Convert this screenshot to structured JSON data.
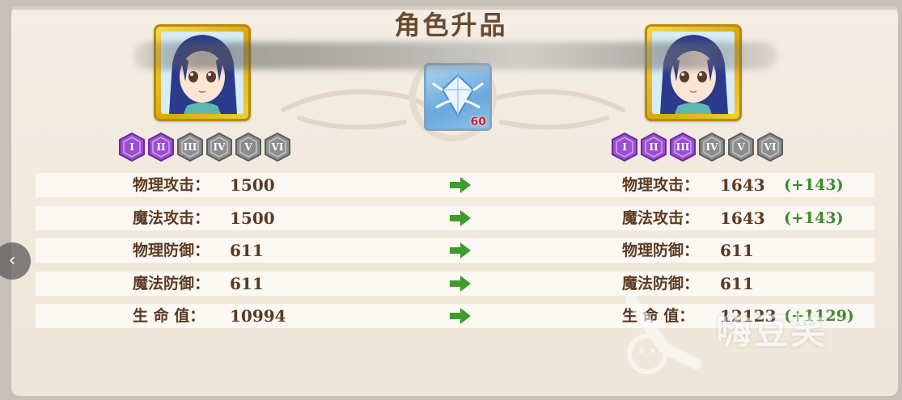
{
  "title": "角色升品",
  "before": {
    "ranks": [
      {
        "label": "I",
        "active": true
      },
      {
        "label": "II",
        "active": true
      },
      {
        "label": "III",
        "active": false
      },
      {
        "label": "IV",
        "active": false
      },
      {
        "label": "V",
        "active": false
      },
      {
        "label": "VI",
        "active": false
      }
    ]
  },
  "after": {
    "ranks": [
      {
        "label": "I",
        "active": true
      },
      {
        "label": "II",
        "active": true
      },
      {
        "label": "III",
        "active": true
      },
      {
        "label": "IV",
        "active": false
      },
      {
        "label": "V",
        "active": false
      },
      {
        "label": "VI",
        "active": false
      }
    ]
  },
  "material": {
    "icon": "crystal-icon",
    "count": "60"
  },
  "stats": [
    {
      "label": "物理攻击：",
      "before": "1500",
      "after": "1643",
      "diff": "(+143)"
    },
    {
      "label": "魔法攻击：",
      "before": "1500",
      "after": "1643",
      "diff": "(+143)"
    },
    {
      "label": "物理防御：",
      "before": "611",
      "after": "611",
      "diff": ""
    },
    {
      "label": "魔法防御：",
      "before": "611",
      "after": "611",
      "diff": ""
    },
    {
      "label": "生 命 值：",
      "before": "10994",
      "after": "12123",
      "diff": "(+1129)"
    }
  ],
  "nav": {
    "prev": "‹"
  },
  "watermark": {
    "text": "嗨豆笑"
  },
  "colors": {
    "rank_active": "#9b4fd0",
    "rank_inactive": "#8d8d8d",
    "diff": "#3c8a2c",
    "arrow": "#3f9b2e",
    "text": "#5a3a22"
  }
}
